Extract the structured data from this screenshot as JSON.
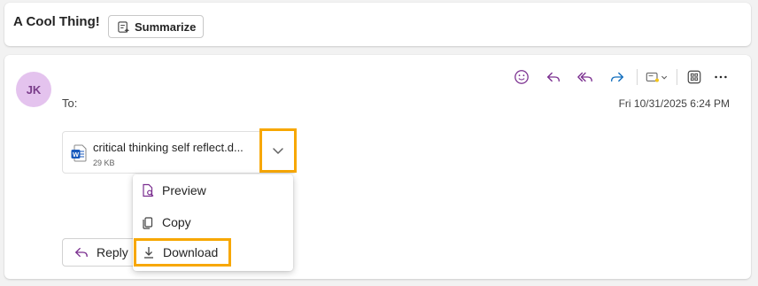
{
  "header": {
    "subject": "A Cool Thing!",
    "summarize_label": "Summarize"
  },
  "message": {
    "avatar_initials": "JK",
    "to_label": "To:",
    "date": "Fri 10/31/2025 6:24 PM",
    "toolbar": [
      "smile-icon",
      "reply-icon",
      "reply-all-icon",
      "forward-icon",
      "mark-dropdown-icon",
      "apps-icon",
      "more-icon"
    ]
  },
  "attachment": {
    "name": "critical thinking self reflect.d...",
    "size": "29 KB"
  },
  "menu": {
    "items": [
      {
        "label": "Preview",
        "icon": "preview-icon"
      },
      {
        "label": "Copy",
        "icon": "copy-icon"
      },
      {
        "label": "Download",
        "icon": "download-icon"
      }
    ]
  },
  "reply_label": "Reply",
  "colors": {
    "accent": "#7a2e8f",
    "forward": "#0f6cbd",
    "highlight": "#f7a700",
    "avatar_bg": "#e4c3ee"
  }
}
